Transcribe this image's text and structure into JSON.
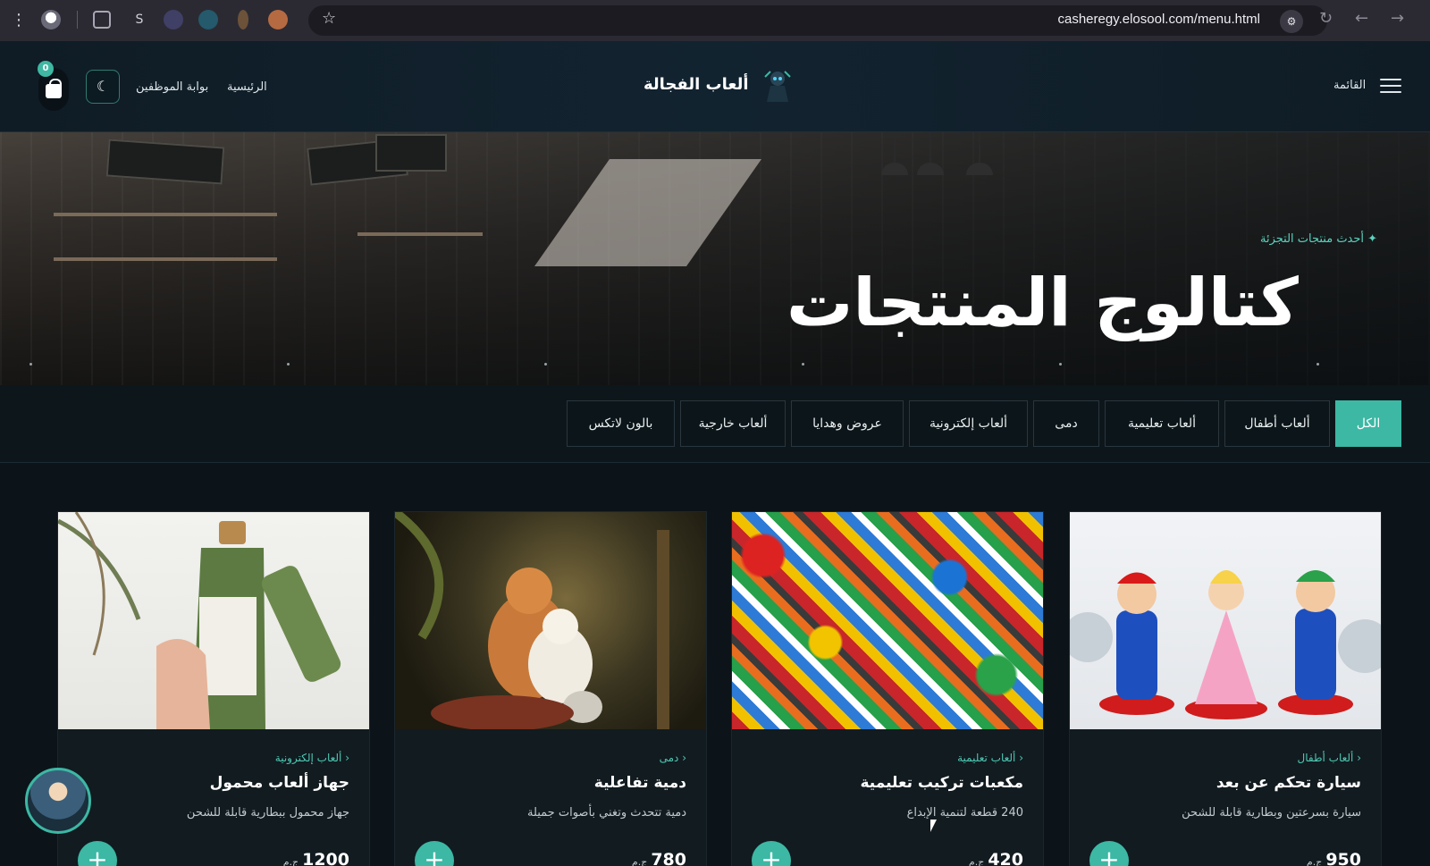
{
  "browser": {
    "url": "casheregy.elosool.com/menu.html"
  },
  "header": {
    "brand_name": "ألعاب الفجالة",
    "nav_home": "الرئيسية",
    "nav_staff": "بوابة الموظفين",
    "menu_label": "القائمة",
    "cart_count": "0",
    "theme_icon": "☾"
  },
  "hero": {
    "tag": "✦ أحدث منتجات التجزئة",
    "title": "كتالوج المنتجات"
  },
  "categories": [
    {
      "label": "الكل",
      "active": true
    },
    {
      "label": "ألعاب أطفال"
    },
    {
      "label": "ألعاب تعليمية"
    },
    {
      "label": "دمى"
    },
    {
      "label": "ألعاب إلكترونية"
    },
    {
      "label": "عروض وهدايا"
    },
    {
      "label": "ألعاب خارجية"
    },
    {
      "label": "بالون لاتكس"
    }
  ],
  "products": [
    {
      "category": "‹ ألعاب أطفال",
      "title": "سيارة تحكم عن بعد",
      "description": "سيارة بسرعتين وبطارية قابلة للشحن",
      "price": "950",
      "currency": "ج.م",
      "image": "mario-figures"
    },
    {
      "category": "‹ ألعاب تعليمية",
      "title": "مكعبات تركيب تعليمية",
      "description": "240 قطعة لتنمية الإبداع",
      "price": "420",
      "currency": "ج.م",
      "image": "lego-bricks"
    },
    {
      "category": "‹ دمى",
      "title": "دمية تفاعلية",
      "description": "دمية تتحدث وتغني بأصوات جميلة",
      "price": "780",
      "currency": "ج.م",
      "image": "cats-painting"
    },
    {
      "category": "‹ ألعاب إلكترونية",
      "title": "جهاز ألعاب محمول",
      "description": "جهاز محمول ببطارية قابلة للشحن",
      "price": "1200",
      "currency": "ج.م",
      "image": "shampoo-bottle"
    }
  ],
  "colors": {
    "accent": "#3cb8a4",
    "background": "#0c1419"
  }
}
